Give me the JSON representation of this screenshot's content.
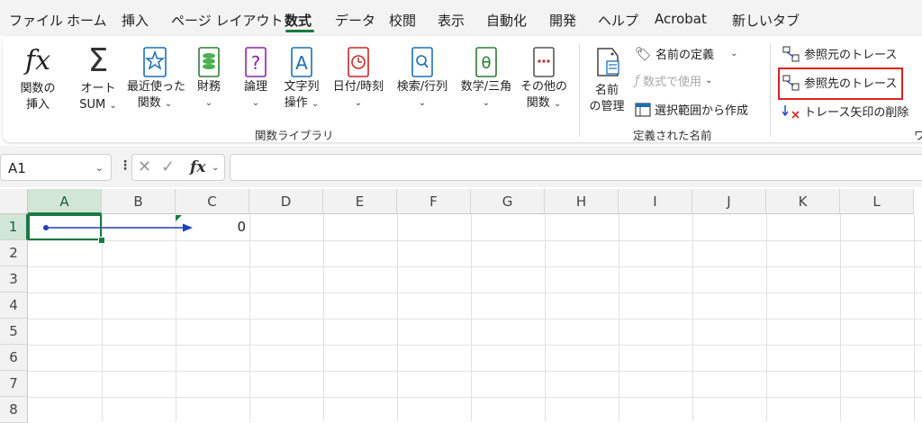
{
  "menu": {
    "tabs": [
      "ファイル",
      "ホーム",
      "挿入",
      "ページ レイアウト",
      "数式",
      "データ",
      "校閲",
      "表示",
      "自動化",
      "開発",
      "ヘルプ",
      "Acrobat",
      "新しいタブ"
    ],
    "active": "数式"
  },
  "ribbon": {
    "function_library": {
      "insert_fn": {
        "line1": "関数の",
        "line2": "挿入"
      },
      "autosum": {
        "line1": "オート",
        "line2": "SUM"
      },
      "recent": {
        "line1": "最近使った",
        "line2": "関数"
      },
      "financial": {
        "line1": "財務"
      },
      "logical": {
        "line1": "論理"
      },
      "text": {
        "line1": "文字列",
        "line2": "操作"
      },
      "datetime": {
        "line1": "日付/時刻"
      },
      "lookup": {
        "line1": "検索/行列"
      },
      "math": {
        "line1": "数学/三角"
      },
      "more": {
        "line1": "その他の",
        "line2": "関数"
      },
      "group_label": "関数ライブラリ"
    },
    "defined_names": {
      "name_manager": {
        "line1": "名前",
        "line2": "の管理"
      },
      "define_name": "名前の定義",
      "use_in_formula": "数式で使用",
      "create_from_selection": "選択範囲から作成",
      "group_label": "定義された名前"
    },
    "formula_auditing": {
      "trace_precedents": "参照元のトレース",
      "trace_dependents": "参照先のトレース",
      "remove_arrows": "トレース矢印の削除",
      "group_label_partial": "ワ"
    }
  },
  "formula_bar": {
    "name_box": "A1",
    "fx": "fx",
    "formula": ""
  },
  "sheet": {
    "columns": [
      "A",
      "B",
      "C",
      "D",
      "E",
      "F",
      "G",
      "H",
      "I",
      "J",
      "K",
      "L"
    ],
    "rows": [
      "1",
      "2",
      "3",
      "4",
      "5",
      "6",
      "7",
      "8"
    ],
    "selected_cell": "A1",
    "cells": {
      "C1": "0"
    }
  },
  "colors": {
    "accent": "#1a7a43",
    "trace_arrow": "#1f3fbf",
    "highlight": "#e02020"
  }
}
